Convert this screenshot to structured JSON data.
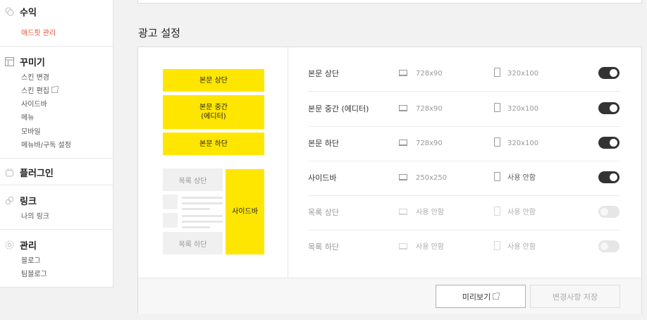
{
  "sidebar": {
    "revenue": {
      "title": "수익",
      "icon": "coin-icon",
      "items": [
        "애드핏 관리"
      ]
    },
    "design": {
      "title": "꾸미기",
      "icon": "layout-icon",
      "items": [
        "스킨 변경",
        "스킨 편집",
        "사이드바",
        "메뉴",
        "모바일",
        "메뉴바/구독 설정"
      ]
    },
    "plugin": {
      "title": "플러그인",
      "icon": "plugin-icon"
    },
    "link": {
      "title": "링크",
      "icon": "link-icon",
      "items": [
        "나의 링크"
      ]
    },
    "manage": {
      "title": "관리",
      "icon": "gear-icon",
      "items": [
        "블로그",
        "팀블로그"
      ]
    }
  },
  "main": {
    "section_title": "광고 설정",
    "preview": {
      "body_top": "본문 상단",
      "body_middle": "본문 중간\n(에디터)",
      "body_bottom": "본문 하단",
      "list_top": "목록 상단",
      "list_bottom": "목록 하단",
      "sidebar": "사이드바"
    },
    "rows": [
      {
        "label": "본문 상단",
        "pc": "728x90",
        "mobile": "320x100",
        "enabled": true
      },
      {
        "label": "본문 중간 (에디터)",
        "pc": "728x90",
        "mobile": "320x100",
        "enabled": true
      },
      {
        "label": "본문 하단",
        "pc": "728x90",
        "mobile": "320x100",
        "enabled": true
      },
      {
        "label": "사이드바",
        "pc": "250x250",
        "mobile": "사용 안함",
        "enabled": true
      },
      {
        "label": "목록 상단",
        "pc": "사용 안함",
        "mobile": "사용 안함",
        "enabled": false
      },
      {
        "label": "목록 하단",
        "pc": "사용 안함",
        "mobile": "사용 안함",
        "enabled": false
      }
    ],
    "buttons": {
      "preview": "미리보기",
      "save": "변경사항 저장"
    }
  },
  "colors": {
    "accent": "#e3543d",
    "ad_slot": "#ffe600",
    "toggle_on": "#333333"
  }
}
